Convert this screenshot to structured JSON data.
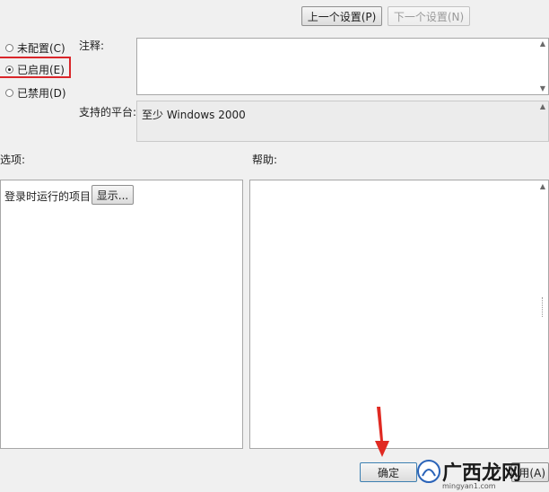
{
  "nav": {
    "prev_setting": "上一个设置(P)",
    "next_setting": "下一个设置(N)"
  },
  "state": {
    "options": [
      {
        "label": "未配置(C)",
        "checked": false
      },
      {
        "label": "已启用(E)",
        "checked": true
      },
      {
        "label": "已禁用(D)",
        "checked": false
      }
    ]
  },
  "comment": {
    "label": "注释:",
    "value": ""
  },
  "platform": {
    "label": "支持的平台:",
    "value": "至少 Windows 2000"
  },
  "options_panel": {
    "label": "选项:",
    "item_label": "登录时运行的项目",
    "show_button": "显示..."
  },
  "help_panel": {
    "label": "帮助:"
  },
  "footer": {
    "ok": "确定",
    "apply": "用(A)"
  },
  "watermark": {
    "text": "广西龙网",
    "url": "mingyan1.com"
  },
  "colors": {
    "highlight_border": "#d9262a",
    "arrow": "#e02a22"
  }
}
